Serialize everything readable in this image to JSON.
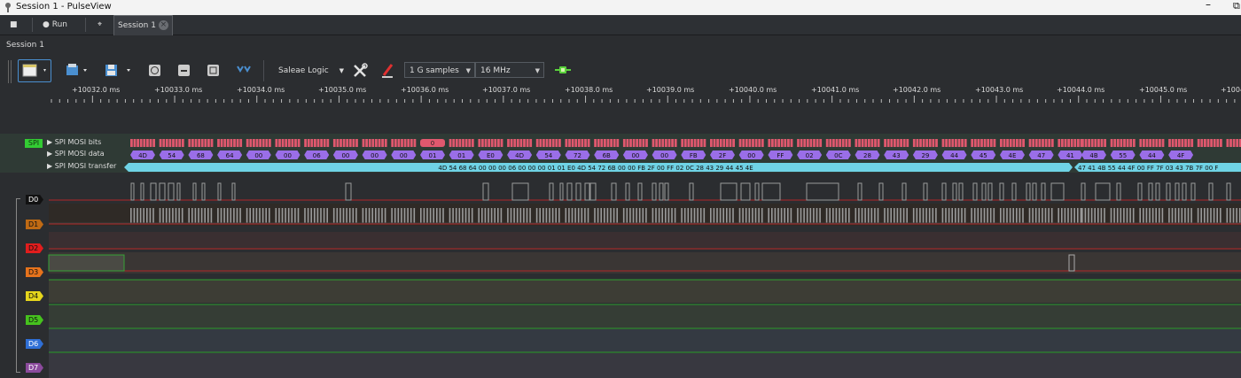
{
  "window": {
    "title": "Session 1 - PulseView"
  },
  "tabs": [
    {
      "label": "■"
    },
    {
      "label": "● Run"
    },
    {
      "label": "⌖"
    },
    {
      "label": "Session 1"
    }
  ],
  "session_label": "Session 1",
  "toolbar": {
    "device": "Saleae Logic",
    "samples": "1 G samples",
    "samplerate": "16 MHz"
  },
  "ruler": {
    "labels": [
      "+10032.0 ms",
      "+10033.0 ms",
      "+10034.0 ms",
      "+10035.0 ms",
      "+10036.0 ms",
      "+10037.0 ms",
      "+10038.0 ms",
      "+10039.0 ms",
      "+10040.0 ms",
      "+10041.0 ms",
      "+10042.0 ms",
      "+10043.0 ms",
      "+10044.0 ms",
      "+10045.0 ms",
      "+1004"
    ]
  },
  "decoder": {
    "badge": "SPI",
    "rows": [
      "SPI MOSI bits",
      "SPI MOSI data",
      "SPI MOSI transfer"
    ],
    "bits_marker": "0",
    "data_bytes": [
      "4D",
      "54",
      "68",
      "64",
      "00",
      "00",
      "06",
      "00",
      "00",
      "00",
      "01",
      "01",
      "E0",
      "4D",
      "54",
      "72",
      "6B",
      "00",
      "00",
      "FB",
      "2F",
      "00",
      "FF",
      "02",
      "0C",
      "28",
      "43",
      "29",
      "44",
      "45",
      "4E",
      "47",
      "41",
      "4B",
      "55",
      "44",
      "4F"
    ],
    "transfer_1": "4D 54 68 64 00 00 00 06 00 00 00 01 01 E0 4D 54 72 6B 00 00 FB 2F 00 FF 02 0C 28 43 29 44 45 4E",
    "transfer_2": "47 41 4B 55 44 4F 00 FF 7F 03 43 7B 7F 00 F"
  },
  "channels": [
    {
      "label": "D0",
      "color": "#111111",
      "text": "#ffffff"
    },
    {
      "label": "D1",
      "color": "#c06a14",
      "text": "#111111"
    },
    {
      "label": "D2",
      "color": "#e11d1d",
      "text": "#111111"
    },
    {
      "label": "D3",
      "color": "#e6731c",
      "text": "#111111"
    },
    {
      "label": "D4",
      "color": "#e5d51c",
      "text": "#111111"
    },
    {
      "label": "D5",
      "color": "#46c11e",
      "text": "#111111"
    },
    {
      "label": "D6",
      "color": "#2f6fd6",
      "text": "#ffffff"
    },
    {
      "label": "D7",
      "color": "#8b4a9c",
      "text": "#ffffff"
    }
  ],
  "colors": {
    "accent_spi": "#33cc33",
    "bits_fill": "#e0586e",
    "data_fill": "#9a6ee8",
    "transfer_fill": "#6fd3e6"
  }
}
